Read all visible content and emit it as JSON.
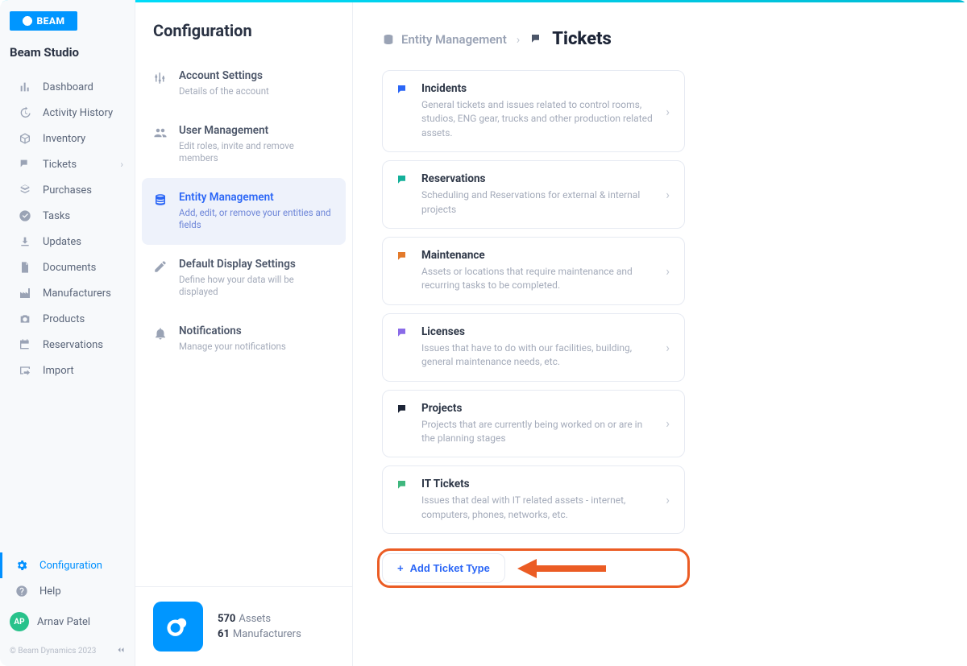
{
  "brand": {
    "logo_text": "BEAM",
    "studio_name": "Beam Studio"
  },
  "sidebar": {
    "items": [
      {
        "label": "Dashboard"
      },
      {
        "label": "Activity History"
      },
      {
        "label": "Inventory"
      },
      {
        "label": "Tickets",
        "has_submenu": true,
        "submenu_icon": "chevron-right"
      },
      {
        "label": "Purchases"
      },
      {
        "label": "Tasks"
      },
      {
        "label": "Updates"
      },
      {
        "label": "Documents"
      },
      {
        "label": "Manufacturers"
      },
      {
        "label": "Products"
      },
      {
        "label": "Reservations"
      },
      {
        "label": "Import"
      }
    ],
    "bottom": [
      {
        "label": "Configuration",
        "active": true
      },
      {
        "label": "Help"
      }
    ],
    "user": {
      "initials": "AP",
      "name": "Arnav Patel"
    },
    "copyright": "© Beam Dynamics 2023"
  },
  "settings": {
    "title": "Configuration",
    "items": [
      {
        "title": "Account Settings",
        "sub": "Details of the account"
      },
      {
        "title": "User Management",
        "sub": "Edit roles, invite and remove members"
      },
      {
        "title": "Entity Management",
        "sub": "Add, edit, or remove your entities and fields",
        "active": true
      },
      {
        "title": "Default Display Settings",
        "sub": "Define how your data will be displayed"
      },
      {
        "title": "Notifications",
        "sub": "Manage your notifications"
      }
    ],
    "footer": {
      "assets_count": "570",
      "assets_label": "Assets",
      "manufacturers_count": "61",
      "manufacturers_label": "Manufacturers"
    }
  },
  "main": {
    "breadcrumb": {
      "parent": "Entity Management",
      "current": "Tickets"
    },
    "tickets": [
      {
        "title": "Incidents",
        "desc": "General tickets and issues related to control rooms, studios, ENG gear, trucks and other production related assets.",
        "color": "#2b66f6"
      },
      {
        "title": "Reservations",
        "desc": "Scheduling and Reservations for external & internal projects",
        "color": "#14b09a"
      },
      {
        "title": "Maintenance",
        "desc": "Assets or locations that require maintenance and recurring tasks to be completed.",
        "color": "#e37a2b"
      },
      {
        "title": "Licenses",
        "desc": "Issues that have to do with our facilities, building, general maintenance needs, etc.",
        "color": "#8a6be8"
      },
      {
        "title": "Projects",
        "desc": "Projects that are currently being worked on or are in the planning stages",
        "color": "#1d2537"
      },
      {
        "title": "IT Tickets",
        "desc": "Issues that deal with IT related assets - internet, computers, phones, networks, etc.",
        "color": "#3fb77e"
      }
    ],
    "add_button": "Add Ticket Type",
    "annotation_arrow_color": "#eb5c24"
  }
}
